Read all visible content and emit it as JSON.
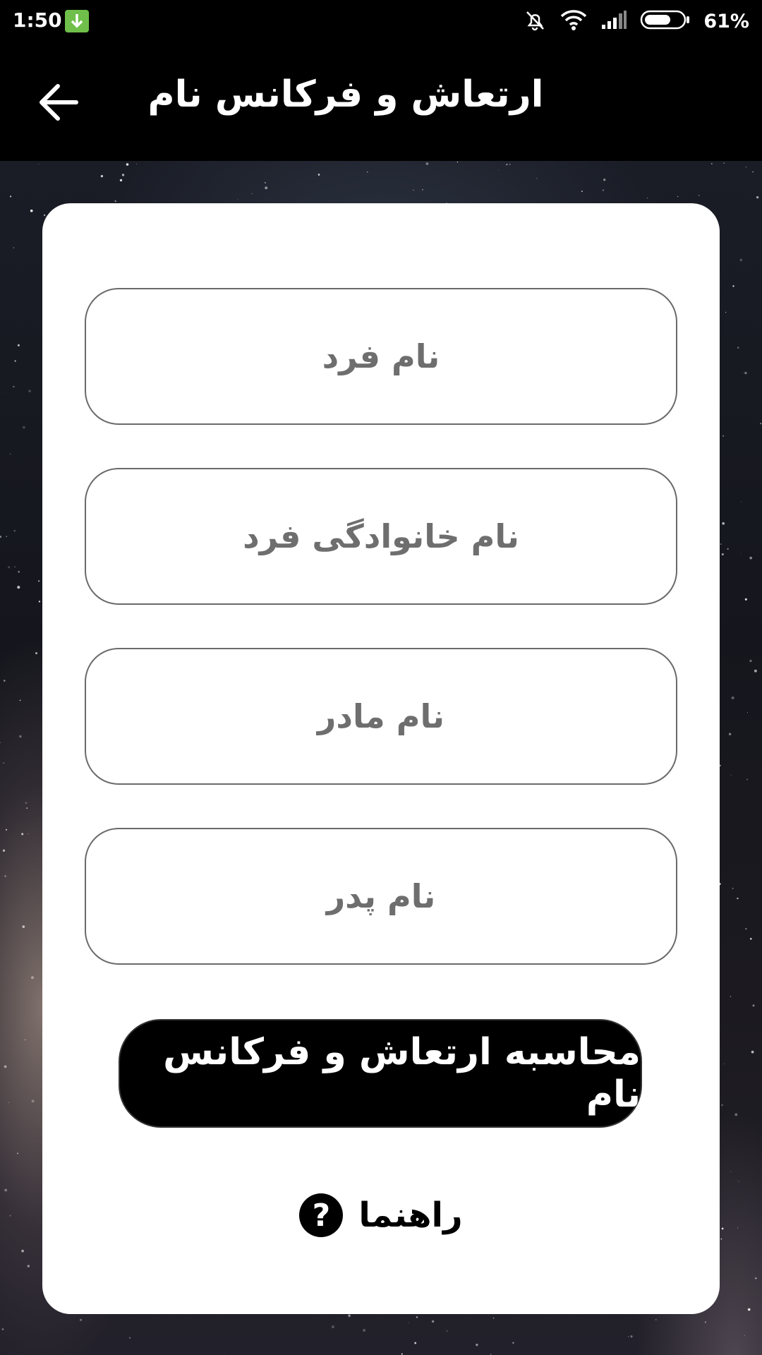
{
  "status_bar": {
    "time": "1:50",
    "battery_percent": "61%"
  },
  "app_bar": {
    "title": "ارتعاش و فرکانس نام"
  },
  "form": {
    "fields": [
      {
        "placeholder": "نام فرد"
      },
      {
        "placeholder": "نام خانوادگی فرد"
      },
      {
        "placeholder": "نام مادر"
      },
      {
        "placeholder": "نام پدر"
      }
    ],
    "submit_label": "محاسبه ارتعاش و فرکانس نام",
    "help_label": "راهنما",
    "help_icon_glyph": "?"
  },
  "colors": {
    "bar": "#000000",
    "card": "#ffffff",
    "field_border": "#6a6a6a",
    "download_badge": "#6fbf4a"
  }
}
